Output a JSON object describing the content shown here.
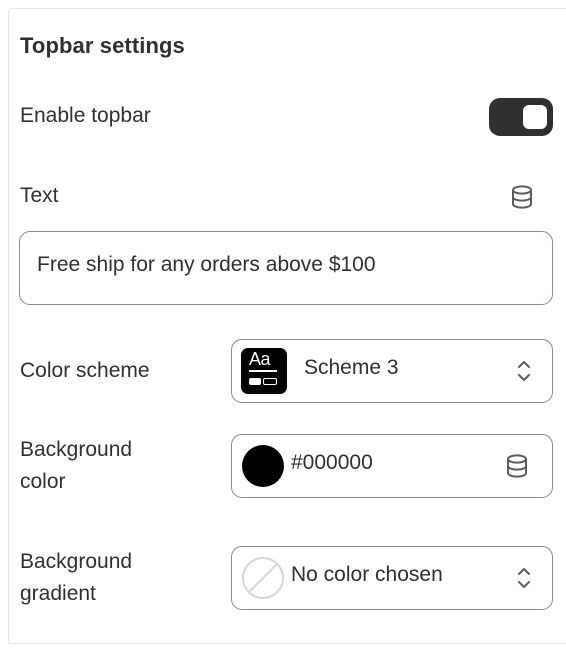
{
  "section": {
    "title": "Topbar settings"
  },
  "enable_topbar": {
    "label": "Enable topbar",
    "enabled": true
  },
  "text": {
    "label": "Text",
    "value": "Free ship for any orders above $100",
    "dynamic_source_icon": "database-icon"
  },
  "color_scheme": {
    "label": "Color scheme",
    "swatch_text": "Aa",
    "value": "Scheme 3",
    "swatch_color": "#000000"
  },
  "background_color": {
    "label_line1": "Background",
    "label_line2": "color",
    "value": "#000000",
    "swatch_color": "#000000",
    "dynamic_source_icon": "database-icon"
  },
  "background_gradient": {
    "label_line1": "Background",
    "label_line2": "gradient",
    "value": "No color chosen"
  }
}
